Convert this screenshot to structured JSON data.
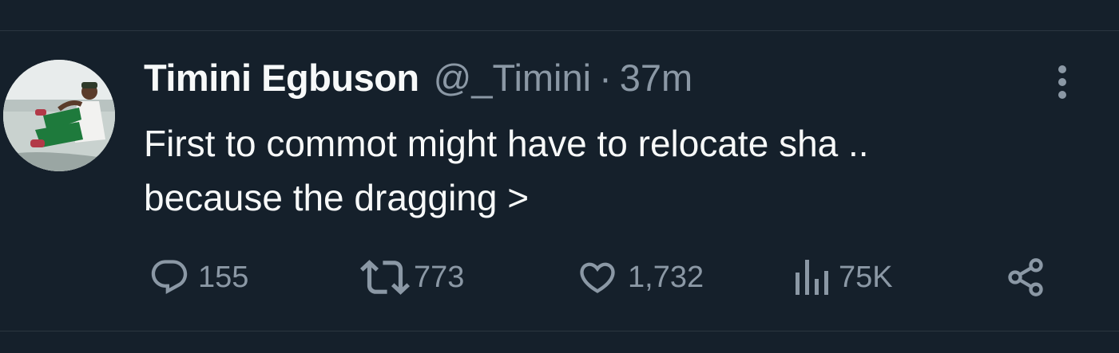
{
  "tweet": {
    "author": {
      "display_name": "Timini Egbuson",
      "handle": "@_Timini",
      "separator": "·",
      "time": "37m"
    },
    "text_line1": "First to commot might have to relocate sha ..",
    "text_line2": "because the dragging >",
    "stats": {
      "replies": "155",
      "retweets": "773",
      "likes": "1,732",
      "views": "75K"
    }
  },
  "colors": {
    "background": "#15202b",
    "primary_text": "#f7f9f9",
    "secondary_text": "#8b98a5",
    "divider": "#2b3640"
  },
  "icons": [
    "more-vertical-icon",
    "reply-icon",
    "retweet-icon",
    "like-icon",
    "views-icon",
    "share-icon"
  ]
}
